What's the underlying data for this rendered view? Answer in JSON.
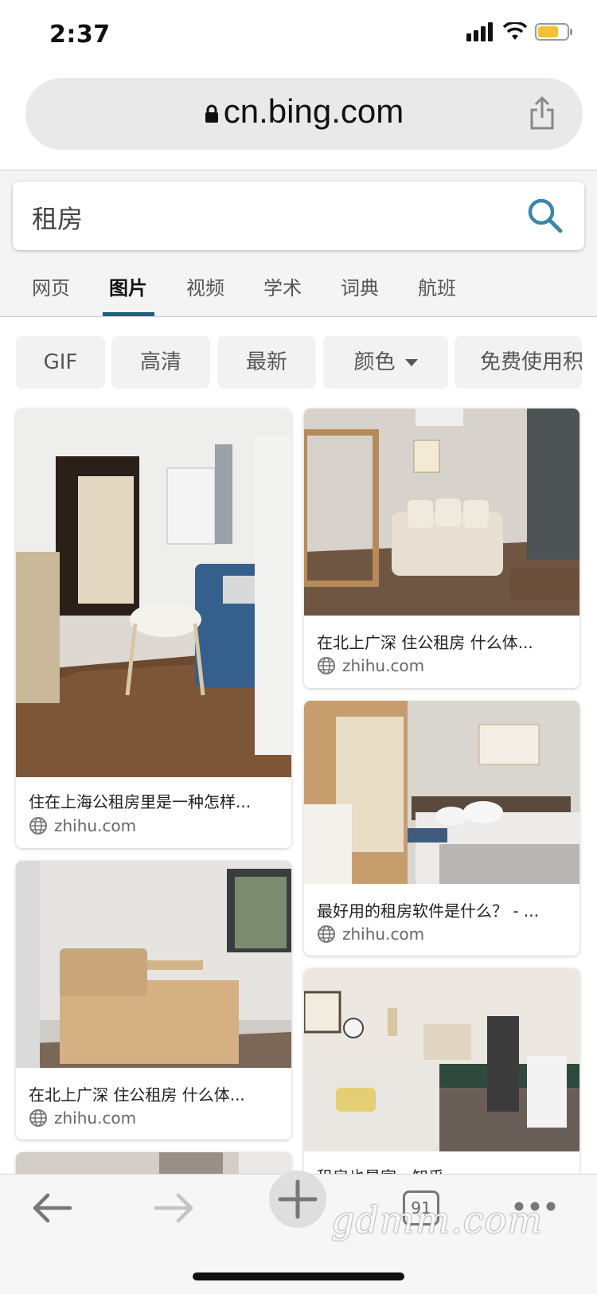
{
  "status_bar": {
    "time": "2:37"
  },
  "browser": {
    "url": "cn.bing.com",
    "tab_count": "91"
  },
  "search": {
    "query": "租房"
  },
  "tabs": [
    {
      "label": "网页",
      "active": false
    },
    {
      "label": "图片",
      "active": true
    },
    {
      "label": "视频",
      "active": false
    },
    {
      "label": "学术",
      "active": false
    },
    {
      "label": "词典",
      "active": false
    },
    {
      "label": "航班",
      "active": false
    }
  ],
  "filters": [
    "GIF",
    "高清",
    "最新",
    "颜色",
    "免费使用积"
  ],
  "results": [
    {
      "title": "住在上海公租房里是一种怎样...",
      "source": "zhihu.com"
    },
    {
      "title": "在北上广深 住公租房 什么体...",
      "source": "zhihu.com"
    },
    {
      "title": "最好用的租房软件是什么？ - ...",
      "source": "zhihu.com"
    },
    {
      "title": "在北上广深 住公租房 什么体...",
      "source": "zhihu.com"
    },
    {
      "title": "租房也是家 - 知乎",
      "source": ""
    }
  ],
  "watermark": "gdmm.com",
  "colors": {
    "accent": "#24617c",
    "search_icon": "#3a86a8"
  }
}
